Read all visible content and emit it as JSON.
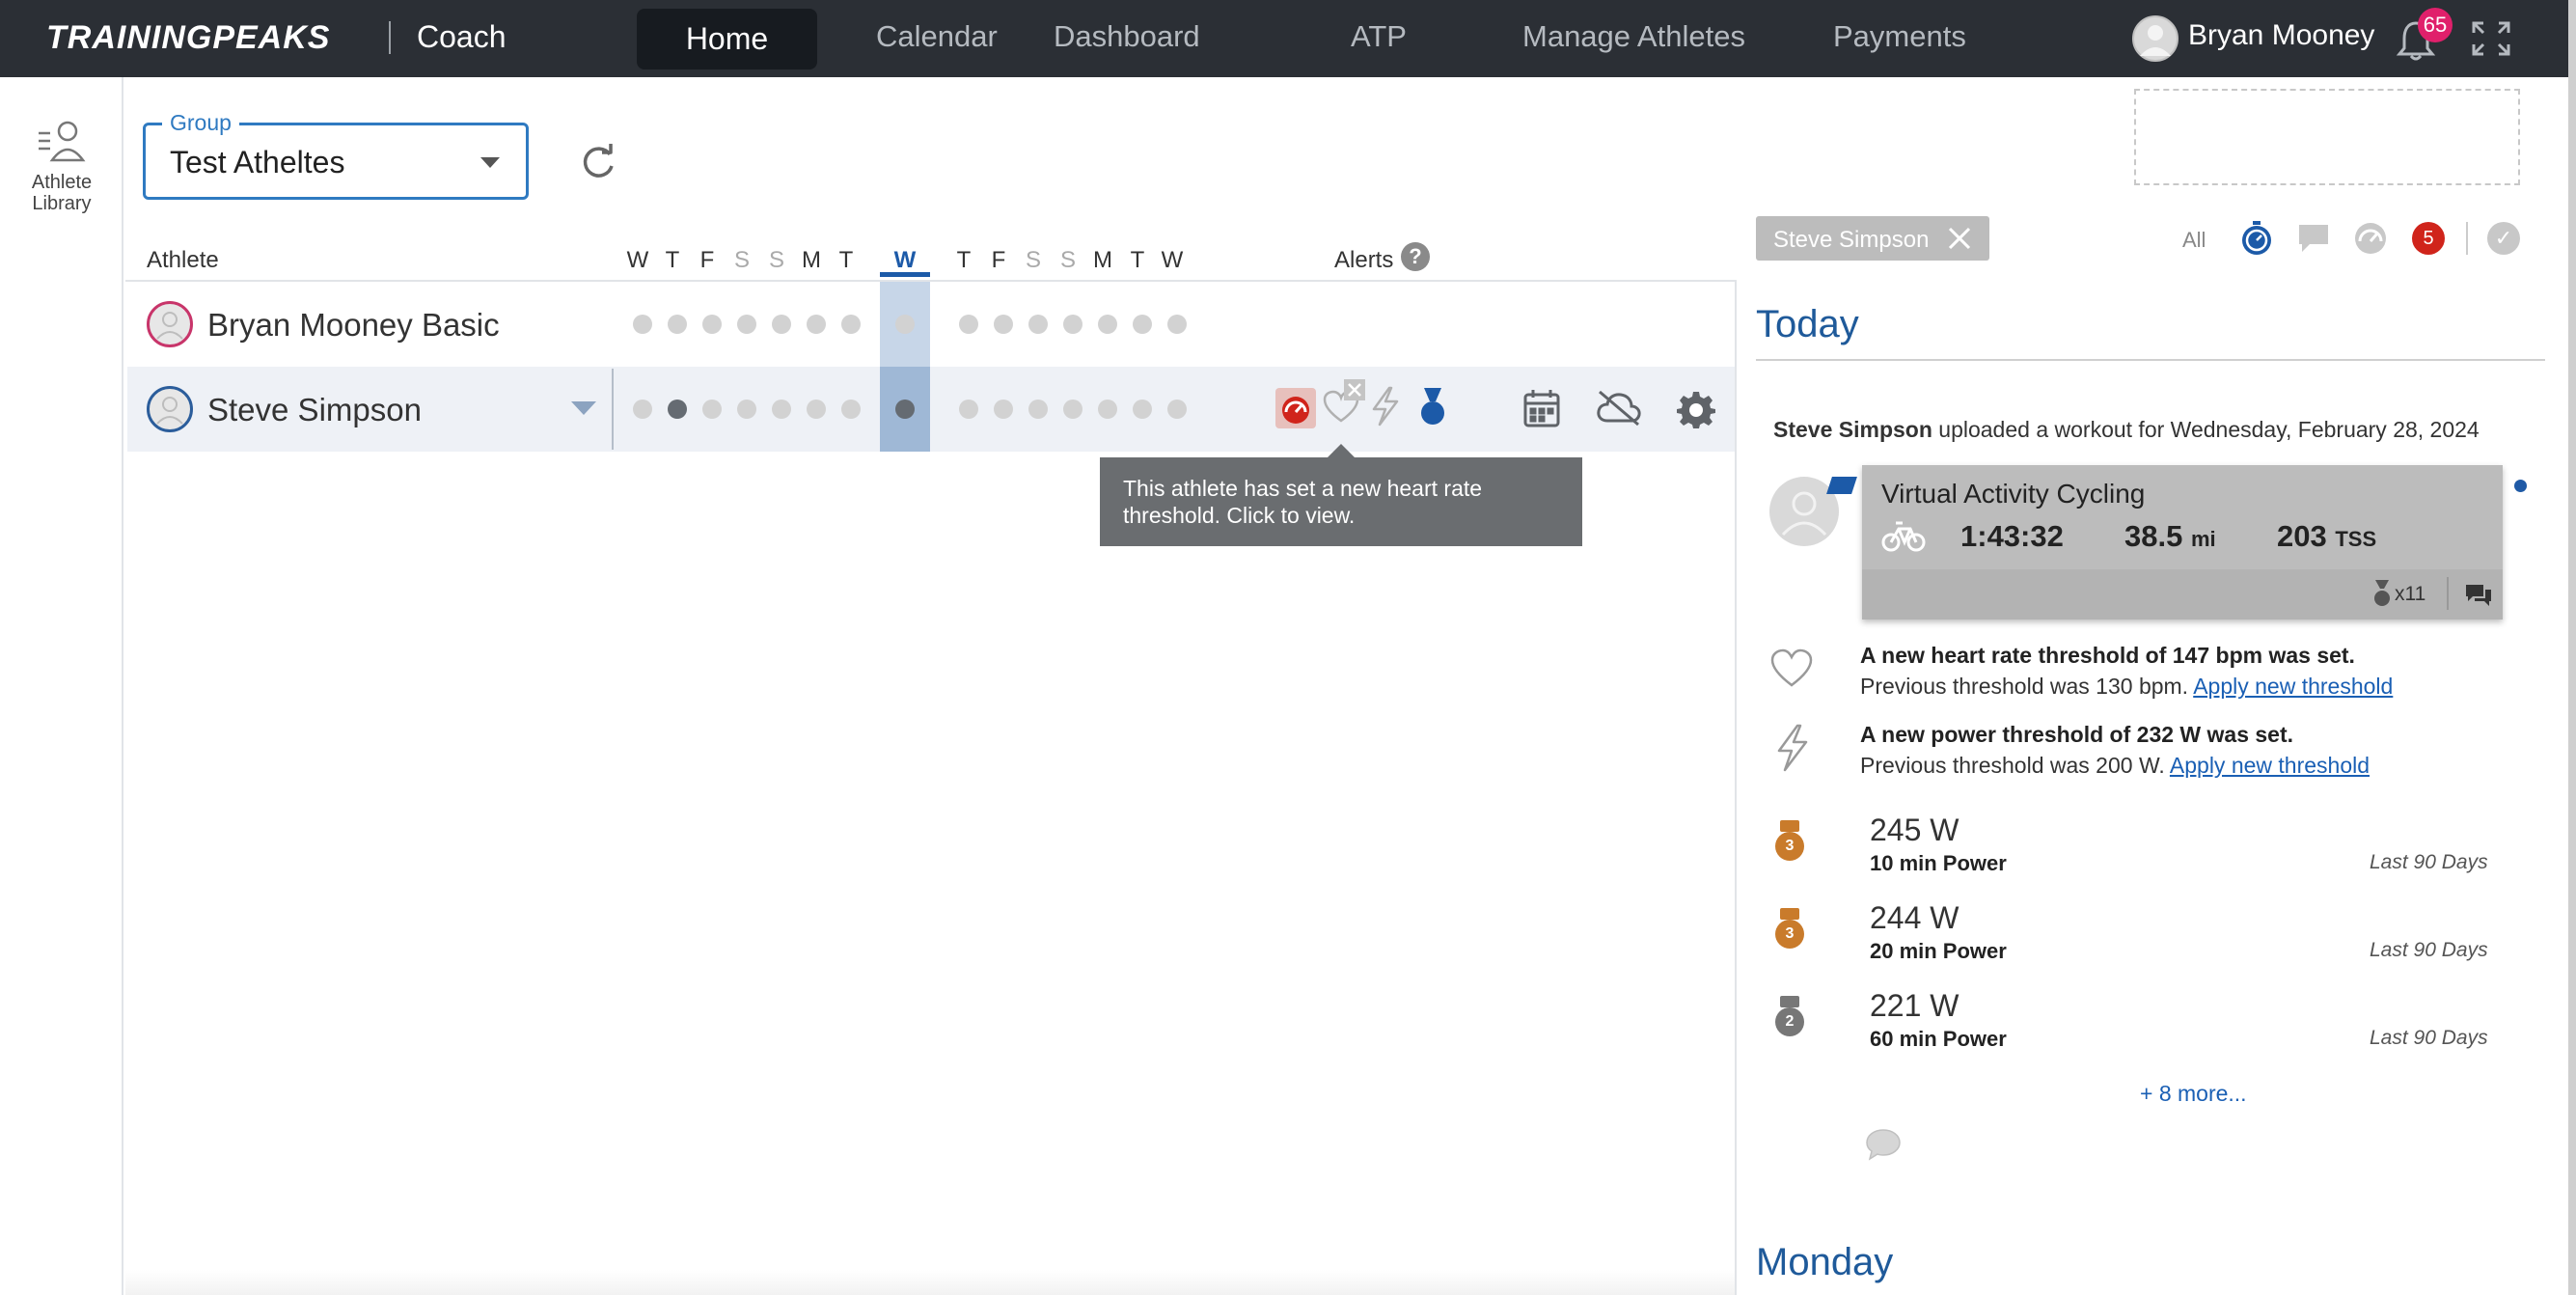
{
  "brand": {
    "logo": "TRAININGPEAKS",
    "product": "Coach"
  },
  "nav": {
    "items": [
      "Home",
      "Calendar",
      "Dashboard",
      "ATP",
      "Manage Athletes",
      "Payments"
    ],
    "active": "Home"
  },
  "user": {
    "name": "Bryan Mooney",
    "notification_count": "65"
  },
  "rail": {
    "label": "Athlete Library"
  },
  "group": {
    "legend": "Group",
    "value": "Test Atheltes"
  },
  "table": {
    "athlete_header": "Athlete",
    "alerts_header": "Alerts",
    "help_glyph": "?",
    "days": [
      "W",
      "T",
      "F",
      "S",
      "S",
      "M",
      "T",
      "W",
      "T",
      "F",
      "S",
      "S",
      "M",
      "T",
      "W"
    ],
    "current_day_index": 7,
    "rows": [
      {
        "name": "Bryan Mooney Basic",
        "avatar_color": "#c8356a",
        "dark_dots": []
      },
      {
        "name": "Steve Simpson",
        "avatar_color": "#2b5d9b",
        "dark_dots": [
          1,
          7
        ]
      }
    ]
  },
  "tooltip": {
    "line1": "This athlete has set a new heart rate",
    "line2": "threshold. Click to view."
  },
  "filter": {
    "chip_label": "Steve Simpson",
    "all_label": "All",
    "badge_count": "5"
  },
  "feed": {
    "today_title": "Today",
    "upload_athlete": "Steve Simpson",
    "upload_text": " uploaded a workout for Wednesday, February 28, 2024",
    "workout": {
      "title": "Virtual Activity Cycling",
      "duration": "1:43:32",
      "distance": "38.5",
      "distance_unit": "mi",
      "tss": "203",
      "tss_unit": "TSS",
      "medal_count": "x11"
    },
    "hr_alert": {
      "title": "A new heart rate threshold of 147 bpm was set.",
      "previous": "Previous threshold was 130 bpm. ",
      "link": "Apply new threshold"
    },
    "power_alert": {
      "title": "A new power threshold of 232 W was set.",
      "previous": "Previous threshold was 200 W. ",
      "link": "Apply new threshold"
    },
    "prs": [
      {
        "rank": "3",
        "value": "245",
        "unit": "W",
        "label": "10 min Power",
        "period": "Last 90 Days",
        "medal": "bronze"
      },
      {
        "rank": "3",
        "value": "244",
        "unit": "W",
        "label": "20 min Power",
        "period": "Last 90 Days",
        "medal": "bronze"
      },
      {
        "rank": "2",
        "value": "221",
        "unit": "W",
        "label": "60 min Power",
        "period": "Last 90 Days",
        "medal": "silver"
      }
    ],
    "more_link": "+ 8 more...",
    "next_day_title": "Monday"
  },
  "colors": {
    "nav_bg": "#2b2f35",
    "accent_blue": "#1f5a9a",
    "alert_red": "#d0241b",
    "badge_pink": "#e0206b"
  }
}
